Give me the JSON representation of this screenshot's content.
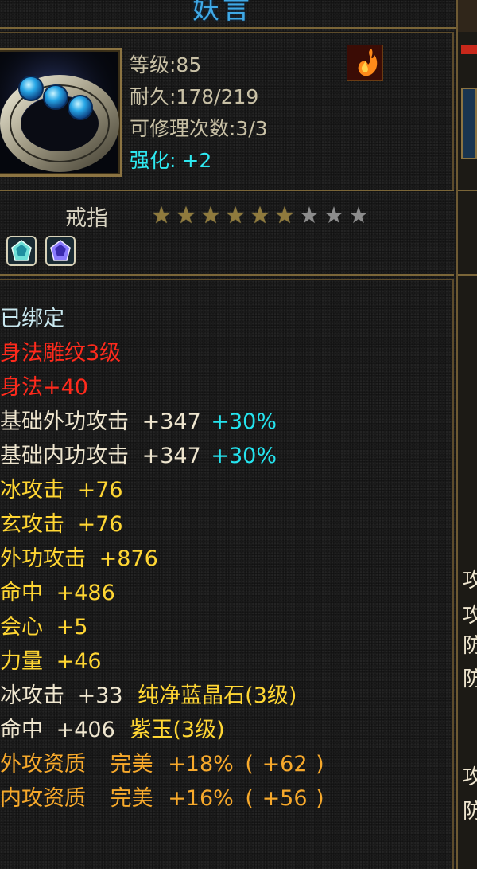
{
  "item": {
    "title": "妖言",
    "level": "等级:85",
    "durability": "耐久:178/219",
    "repairs": "可修理次数:3/3",
    "enhance_label": "强化:",
    "enhance_value": "+2",
    "type": "戒指",
    "stars_total": 9,
    "stars_filled": 6,
    "icon": "jeweled-ring-icon",
    "quality_icon": "fire-emblem-icon",
    "gem_sockets": [
      "gem-socket-icon",
      "gem-socket-icon"
    ]
  },
  "attributes": {
    "bound": "已绑定",
    "engrave": "身法雕纹3级",
    "agility": "身法+40",
    "base_ext_atk": {
      "label": "基础外功攻击",
      "value": "+347",
      "bonus": "+30%"
    },
    "base_int_atk": {
      "label": "基础内功攻击",
      "value": "+347",
      "bonus": "+30%"
    },
    "ice_atk": {
      "label": "冰攻击",
      "value": "+76"
    },
    "xuan_atk": {
      "label": "玄攻击",
      "value": "+76"
    },
    "ext_atk": {
      "label": "外功攻击",
      "value": "+876"
    },
    "hit": {
      "label": "命中",
      "value": "+486"
    },
    "crit": {
      "label": "会心",
      "value": "+5"
    },
    "strength": {
      "label": "力量",
      "value": "+46"
    },
    "gem1": {
      "label": "冰攻击",
      "value": "+33",
      "gem": "纯净蓝晶石",
      "lv": "(3级)"
    },
    "gem2": {
      "label": "命中",
      "value": "+406",
      "gem": "紫玉",
      "lv": "(3级)"
    },
    "apt1": {
      "label": "外攻资质",
      "grade": "完美",
      "pct": "+18%",
      "lp": "(",
      "num": "+62",
      "rp": ")"
    },
    "apt2": {
      "label": "内攻资质",
      "grade": "完美",
      "pct": "+16%",
      "lp": "(",
      "num": "+56",
      "rp": ")"
    }
  },
  "side_panel": {
    "chars": [
      "攻",
      "攻",
      "防",
      "防",
      "攻",
      "防"
    ]
  },
  "colors": {
    "title": "#3fa9e6",
    "enhance": "#2ee8f0",
    "bonus": "#24e4ef",
    "stat_gold": "#ffd633",
    "aptitude": "#f7a92b",
    "engrave": "#ff2a1c",
    "border": "#7b6638"
  }
}
